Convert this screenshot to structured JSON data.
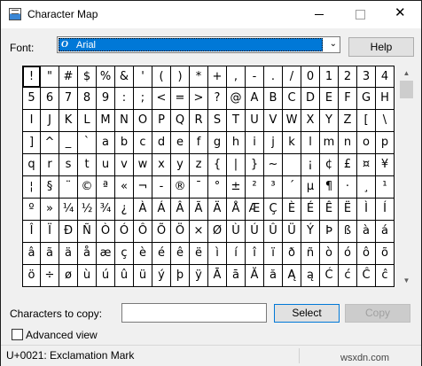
{
  "window": {
    "title": "Character Map"
  },
  "font": {
    "label": "Font:",
    "selected": "Arial"
  },
  "buttons": {
    "help": "Help",
    "select": "Select",
    "copy": "Copy"
  },
  "copy": {
    "label": "Characters to copy:",
    "value": ""
  },
  "advanced": {
    "label": "Advanced view",
    "checked": false
  },
  "status": {
    "text": "U+0021: Exclamation Mark"
  },
  "watermark": "wsxdn.com",
  "grid": {
    "selected_index": 0,
    "rows": [
      [
        "!",
        "\"",
        "#",
        "$",
        "%",
        "&",
        "'",
        "(",
        ")",
        "*",
        "+",
        ",",
        "-",
        ".",
        "/",
        "0",
        "1",
        "2",
        "3",
        "4"
      ],
      [
        "5",
        "6",
        "7",
        "8",
        "9",
        ":",
        ";",
        "<",
        "=",
        ">",
        "?",
        "@",
        "A",
        "B",
        "C",
        "D",
        "E",
        "F",
        "G",
        "H"
      ],
      [
        "I",
        "J",
        "K",
        "L",
        "M",
        "N",
        "O",
        "P",
        "Q",
        "R",
        "S",
        "T",
        "U",
        "V",
        "W",
        "X",
        "Y",
        "Z",
        "[",
        "\\"
      ],
      [
        "]",
        "^",
        "_",
        "`",
        "a",
        "b",
        "c",
        "d",
        "e",
        "f",
        "g",
        "h",
        "i",
        "j",
        "k",
        "l",
        "m",
        "n",
        "o",
        "p"
      ],
      [
        "q",
        "r",
        "s",
        "t",
        "u",
        "v",
        "w",
        "x",
        "y",
        "z",
        "{",
        "|",
        "}",
        "~",
        " ",
        "¡",
        "¢",
        "£",
        "¤",
        "¥"
      ],
      [
        "¦",
        "§",
        "¨",
        "©",
        "ª",
        "«",
        "¬",
        "-",
        "®",
        "¯",
        "°",
        "±",
        "²",
        "³",
        "´",
        "µ",
        "¶",
        "·",
        "¸",
        "¹"
      ],
      [
        "º",
        "»",
        "¼",
        "½",
        "¾",
        "¿",
        "À",
        "Á",
        "Â",
        "Ã",
        "Ä",
        "Å",
        "Æ",
        "Ç",
        "È",
        "É",
        "Ê",
        "Ë",
        "Ì",
        "Í"
      ],
      [
        "Î",
        "Ï",
        "Ð",
        "Ñ",
        "Ò",
        "Ó",
        "Ô",
        "Õ",
        "Ö",
        "×",
        "Ø",
        "Ù",
        "Ú",
        "Û",
        "Ü",
        "Ý",
        "Þ",
        "ß",
        "à",
        "á"
      ],
      [
        "â",
        "ã",
        "ä",
        "å",
        "æ",
        "ç",
        "è",
        "é",
        "ê",
        "ë",
        "ì",
        "í",
        "î",
        "ï",
        "ð",
        "ñ",
        "ò",
        "ó",
        "ô",
        "õ"
      ],
      [
        "ö",
        "÷",
        "ø",
        "ù",
        "ú",
        "û",
        "ü",
        "ý",
        "þ",
        "ÿ",
        "Ā",
        "ā",
        "Ă",
        "ă",
        "Ą",
        "ą",
        "Ć",
        "ć",
        "Ĉ",
        "ĉ"
      ]
    ]
  }
}
